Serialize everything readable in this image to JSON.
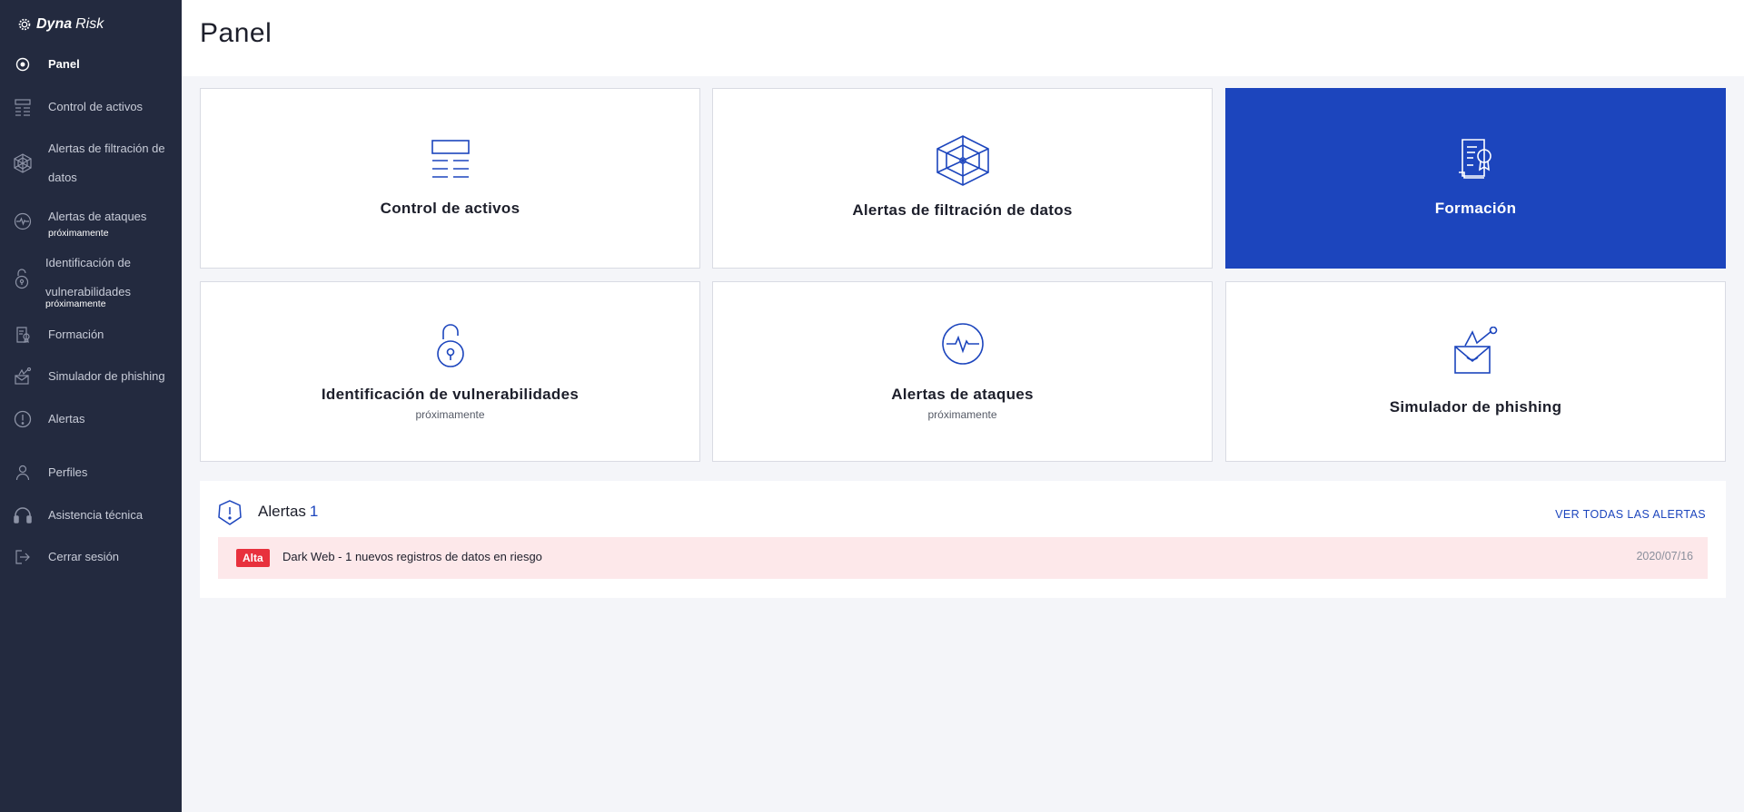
{
  "brand": {
    "name_bold": "Dyna",
    "name_light": "Risk"
  },
  "sidebar": {
    "items": [
      {
        "label": "Panel"
      },
      {
        "label": "Control de activos"
      },
      {
        "label_line1": "Alertas de filtración de",
        "label_line2": "datos"
      },
      {
        "label": "Alertas de ataques",
        "sub": "próximamente"
      },
      {
        "label_line1": "Identificación de",
        "label_line2": "vulnerabilidades",
        "sub": "próximamente"
      },
      {
        "label": "Formación"
      },
      {
        "label": "Simulador de phishing"
      },
      {
        "label": "Alertas"
      },
      {
        "label": "Perfiles"
      },
      {
        "label": "Asistencia técnica"
      },
      {
        "label": "Cerrar sesión"
      }
    ]
  },
  "header": {
    "title": "Panel"
  },
  "cards": [
    {
      "title": "Control de activos",
      "icon": "asset-control-icon"
    },
    {
      "title": "Alertas de filtración de datos",
      "icon": "web-leak-icon"
    },
    {
      "title": "Formación",
      "icon": "certificate-icon"
    },
    {
      "title": "Identificación de vulnerabilidades",
      "sub": "próximamente",
      "icon": "unlock-icon"
    },
    {
      "title": "Alertas de ataques",
      "sub": "próximamente",
      "icon": "pulse-icon"
    },
    {
      "title": "Simulador de phishing",
      "icon": "phishing-icon"
    }
  ],
  "alerts": {
    "title": "Alertas",
    "count": "1",
    "see_all": "VER TODAS LAS ALERTAS",
    "rows": [
      {
        "severity": "Alta",
        "text": "Dark Web - 1 nuevos registros de datos en riesgo",
        "date": "2020/07/16"
      }
    ]
  },
  "colors": {
    "sidebar": "#232a3f",
    "accent": "#1c45bd",
    "alert_bg": "#fde8ea",
    "badge": "#e8313d"
  }
}
